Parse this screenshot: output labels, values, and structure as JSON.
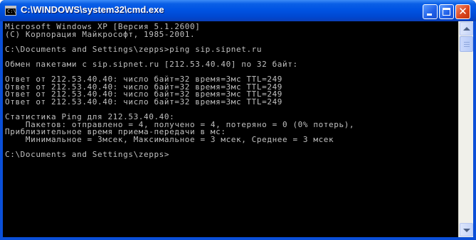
{
  "window": {
    "title": "C:\\WINDOWS\\system32\\cmd.exe",
    "icon": "console-app-icon",
    "icon_glyph": "C:\\"
  },
  "titlebar_buttons": {
    "minimize": "minimize-icon",
    "maximize": "maximize-icon",
    "close": "close-icon",
    "close_glyph": "✕"
  },
  "console": {
    "lines": [
      "Microsoft Windows XP [Версия 5.1.2600]",
      "(С) Корпорация Майкрософт, 1985-2001.",
      "",
      "C:\\Documents and Settings\\zepps>ping sip.sipnet.ru",
      "",
      "Обмен пакетами с sip.sipnet.ru [212.53.40.40] по 32 байт:",
      "",
      "Ответ от 212.53.40.40: число байт=32 время=3мс TTL=249",
      "Ответ от 212.53.40.40: число байт=32 время=3мс TTL=249",
      "Ответ от 212.53.40.40: число байт=32 время=3мс TTL=249",
      "Ответ от 212.53.40.40: число байт=32 время=3мс TTL=249",
      "",
      "Статистика Ping для 212.53.40.40:",
      "    Пакетов: отправлено = 4, получено = 4, потеряно = 0 (0% потерь),",
      "Приблизительное время приема-передачи в мс:",
      "    Минимальное = 3мсек, Максимальное = 3 мсек, Среднее = 3 мсек",
      "",
      "C:\\Documents and Settings\\zepps>"
    ]
  },
  "scrollbar": {
    "up_icon": "scroll-up-arrow-icon",
    "down_icon": "scroll-down-arrow-icon"
  }
}
